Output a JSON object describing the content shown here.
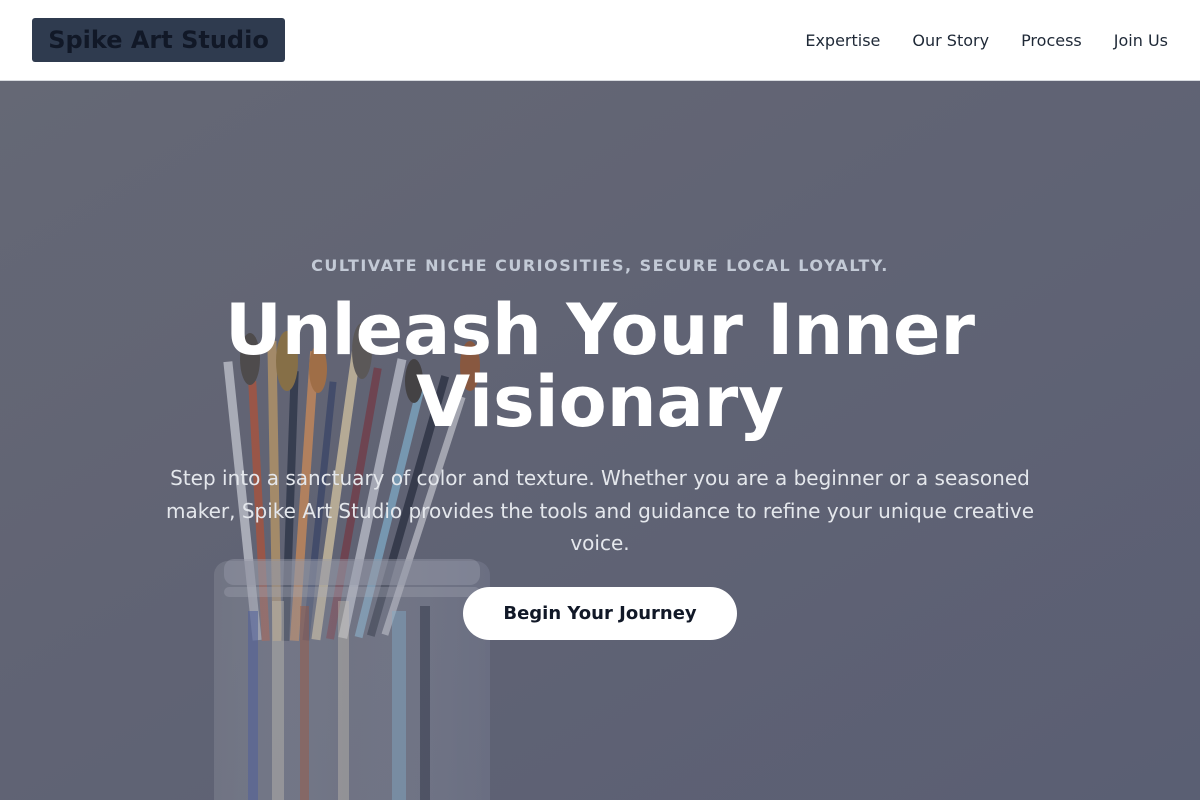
{
  "header": {
    "brand": "Spike Art Studio",
    "nav": [
      {
        "label": "Expertise"
      },
      {
        "label": "Our Story"
      },
      {
        "label": "Process"
      },
      {
        "label": "Join Us"
      }
    ]
  },
  "hero": {
    "eyebrow": "CULTIVATE NICHE CURIOSITIES, SECURE LOCAL LOYALTY.",
    "title": "Unleash Your Inner Visionary",
    "description": "Step into a sanctuary of color and texture. Whether you are a beginner or a seasoned maker, Spike Art Studio provides the tools and guidance to refine your unique creative voice.",
    "cta_label": "Begin Your Journey",
    "background_image": "paintbrushes-in-jar"
  },
  "colors": {
    "header_bg": "#ffffff",
    "brand_bg": "#2f3b4f",
    "brand_text": "#111827",
    "nav_text": "#1f2937",
    "hero_bg": "#676b78",
    "eyebrow_text": "#c3cad6",
    "title_text": "#ffffff",
    "cta_bg": "#ffffff",
    "cta_text": "#111827"
  }
}
